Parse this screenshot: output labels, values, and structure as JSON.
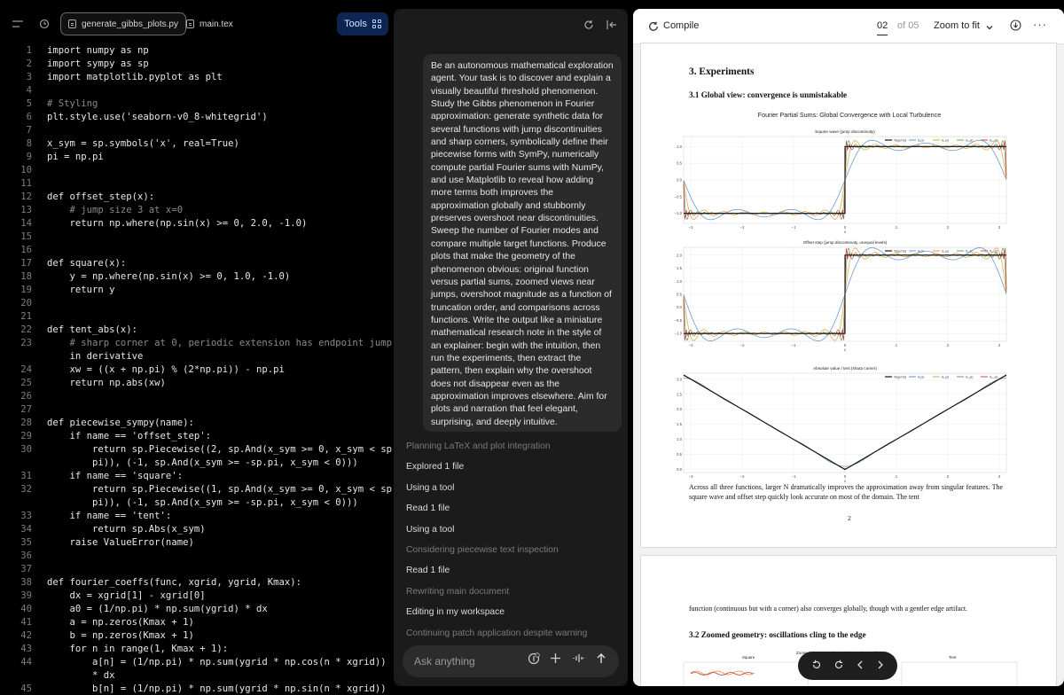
{
  "editor": {
    "tabs": [
      {
        "label": "generate_gibbs_plots.py",
        "active": true
      },
      {
        "label": "main.tex",
        "active": false
      }
    ],
    "tools_label": "Tools",
    "lines": [
      {
        "n": "1",
        "text": "import numpy as np"
      },
      {
        "n": "2",
        "text": "import sympy as sp"
      },
      {
        "n": "3",
        "text": "import matplotlib.pyplot as plt"
      },
      {
        "n": "4",
        "text": ""
      },
      {
        "n": "5",
        "text": "# Styling"
      },
      {
        "n": "6",
        "text": "plt.style.use('seaborn-v0_8-whitegrid')"
      },
      {
        "n": "7",
        "text": ""
      },
      {
        "n": "8",
        "text": "x_sym = sp.symbols('x', real=True)"
      },
      {
        "n": "9",
        "text": "pi = np.pi"
      },
      {
        "n": "10",
        "text": ""
      },
      {
        "n": "11",
        "text": ""
      },
      {
        "n": "12",
        "text": "def offset_step(x):"
      },
      {
        "n": "13",
        "text": "    # jump size 3 at x=0"
      },
      {
        "n": "14",
        "text": "    return np.where(np.sin(x) >= 0, 2.0, -1.0)"
      },
      {
        "n": "15",
        "text": ""
      },
      {
        "n": "16",
        "text": ""
      },
      {
        "n": "17",
        "text": "def square(x):"
      },
      {
        "n": "18",
        "text": "    y = np.where(np.sin(x) >= 0, 1.0, -1.0)"
      },
      {
        "n": "19",
        "text": "    return y"
      },
      {
        "n": "20",
        "text": ""
      },
      {
        "n": "21",
        "text": ""
      },
      {
        "n": "22",
        "text": "def tent_abs(x):"
      },
      {
        "n": "23",
        "text": "    # sharp corner at 0, periodic extension has endpoint jump"
      },
      {
        "n": "",
        "text": "    in derivative"
      },
      {
        "n": "24",
        "text": "    xw = ((x + np.pi) % (2*np.pi)) - np.pi"
      },
      {
        "n": "25",
        "text": "    return np.abs(xw)"
      },
      {
        "n": "26",
        "text": ""
      },
      {
        "n": "27",
        "text": ""
      },
      {
        "n": "28",
        "text": "def piecewise_sympy(name):"
      },
      {
        "n": "29",
        "text": "    if name == 'offset_step':"
      },
      {
        "n": "30",
        "text": "        return sp.Piecewise((2, sp.And(x_sym >= 0, x_sym < sp."
      },
      {
        "n": "",
        "text": "        pi)), (-1, sp.And(x_sym >= -sp.pi, x_sym < 0)))"
      },
      {
        "n": "31",
        "text": "    if name == 'square':"
      },
      {
        "n": "32",
        "text": "        return sp.Piecewise((1, sp.And(x_sym >= 0, x_sym < sp."
      },
      {
        "n": "",
        "text": "        pi)), (-1, sp.And(x_sym >= -sp.pi, x_sym < 0)))"
      },
      {
        "n": "33",
        "text": "    if name == 'tent':"
      },
      {
        "n": "34",
        "text": "        return sp.Abs(x_sym)"
      },
      {
        "n": "35",
        "text": "    raise ValueError(name)"
      },
      {
        "n": "36",
        "text": ""
      },
      {
        "n": "37",
        "text": ""
      },
      {
        "n": "38",
        "text": "def fourier_coeffs(func, xgrid, ygrid, Kmax):"
      },
      {
        "n": "39",
        "text": "    dx = xgrid[1] - xgrid[0]"
      },
      {
        "n": "40",
        "text": "    a0 = (1/np.pi) * np.sum(ygrid) * dx"
      },
      {
        "n": "41",
        "text": "    a = np.zeros(Kmax + 1)"
      },
      {
        "n": "42",
        "text": "    b = np.zeros(Kmax + 1)"
      },
      {
        "n": "43",
        "text": "    for n in range(1, Kmax + 1):"
      },
      {
        "n": "44",
        "text": "        a[n] = (1/np.pi) * np.sum(ygrid * np.cos(n * xgrid))"
      },
      {
        "n": "",
        "text": "        * dx"
      },
      {
        "n": "45",
        "text": "        b[n] = (1/np.pi) * np.sum(ygrid * np.sin(n * xgrid))"
      }
    ]
  },
  "chat": {
    "user_message": "Be an autonomous mathematical exploration agent. Your task is to discover and explain a visually beautiful threshold phenomenon. Study the Gibbs phenomenon in Fourier approximation: generate synthetic data for several functions with jump discontinuities and sharp corners, symbolically define their piecewise forms with SymPy, numerically compute partial Fourier sums with NumPy, and use Matplotlib to reveal how adding more terms both improves the approximation globally and stubbornly preserves overshoot near discontinuities. Sweep the number of Fourier modes and compare multiple target functions. Produce plots that make the geometry of the phenomenon obvious: original function versus partial sums, zoomed views near jumps, overshoot magnitude as a function of truncation order, and comparisons across functions. Write the output like a miniature mathematical research note in the style of an explainer: begin with the intuition, then run the experiments, then extract the pattern, then explain why the overshoot does not disappear even as the approximation improves elsewhere. Aim for plots and narration that feel elegant, surprising, and deeply intuitive.",
    "steps": [
      {
        "label": "Planning LaTeX and plot integration",
        "dim": true
      },
      {
        "label": "Explored 1 file",
        "dim": false
      },
      {
        "label": "Using a tool",
        "dim": false
      },
      {
        "label": "Read 1 file",
        "dim": false
      },
      {
        "label": "Using a tool",
        "dim": false
      },
      {
        "label": "Considering piecewise text inspection",
        "dim": true
      },
      {
        "label": "Read 1 file",
        "dim": false
      },
      {
        "label": "Rewriting main document",
        "dim": true
      },
      {
        "label": "Editing in my workspace",
        "dim": false
      },
      {
        "label": "Continuing patch application despite warning",
        "dim": true
      }
    ],
    "ask_placeholder": "Ask anything"
  },
  "pdf": {
    "compile_label": "Compile",
    "page_current": "02",
    "page_total": "of 05",
    "zoom_label": "Zoom to fit",
    "page2": {
      "section_title": "3.  Experiments",
      "subsection_title": "3.1 Global view: convergence is unmistakable",
      "figure_title": "Fourier Partial Sums: Global Convergence with Local Turbulence",
      "panels": [
        {
          "title": "Square wave (jump discontinuity)",
          "yticks": [
            "1.0",
            "0.5",
            "0.0",
            "−0.5",
            "−1.0"
          ]
        },
        {
          "title": "Offset step (jump discontinuity, unequal levels)",
          "yticks": [
            "2.0",
            "1.5",
            "1.0",
            "0.5",
            "0.0",
            "−0.5",
            "−1.0"
          ]
        },
        {
          "title": "Absolute value / tent (sharp corner)",
          "yticks": [
            "3.0",
            "2.5",
            "2.0",
            "1.5",
            "1.0",
            "0.5",
            "0.0"
          ]
        }
      ],
      "xticks": [
        "−3",
        "−2",
        "−1",
        "0",
        "1",
        "2",
        "3"
      ],
      "xlabel": "x",
      "legend": [
        "Target f(x)",
        "S₅(x)",
        "S₁₅(x)",
        "S₄₅(x)",
        "S₁₂₀(x)"
      ],
      "body": "Across all three functions, larger N dramatically improves the approximation away from singular features. The square wave and offset step quickly look accurate on most of the domain. The tent",
      "page_number": "2"
    },
    "page3": {
      "body": "function (continuous but with a corner) also converges globally, though with a gentler edge artifact.",
      "subsection_title": "3.2 Zoomed geometry: oscillations cling to the edge",
      "mini_title_a": "Square",
      "mini_title_b": "Zoomed Geometry: The Persistent Edge Oscillation",
      "mini_title_c": "Tent"
    }
  },
  "colors": {
    "target": "#111111",
    "s5": "#4c88c5",
    "s15": "#e9923a",
    "s45": "#4e9b48",
    "s120": "#c43a3a"
  },
  "chart_data": [
    {
      "type": "line",
      "title": "Square wave (jump discontinuity)",
      "xlabel": "x",
      "ylabel": "",
      "xlim": [
        -3.14,
        3.14
      ],
      "ylim": [
        -1.3,
        1.3
      ],
      "series": [
        {
          "name": "Target f(x)",
          "values": [
            [
              -3.14,
              -1
            ],
            [
              0,
              -1
            ],
            [
              0,
              1
            ],
            [
              3.14,
              1
            ]
          ]
        },
        {
          "name": "S₅(x)",
          "values": []
        },
        {
          "name": "S₁₅(x)",
          "values": []
        },
        {
          "name": "S₄₅(x)",
          "values": []
        },
        {
          "name": "S₁₂₀(x)",
          "values": []
        }
      ]
    },
    {
      "type": "line",
      "title": "Offset step (jump discontinuity, unequal levels)",
      "xlabel": "x",
      "ylabel": "",
      "xlim": [
        -3.14,
        3.14
      ],
      "ylim": [
        -1.3,
        2.3
      ],
      "series": [
        {
          "name": "Target f(x)",
          "values": [
            [
              -3.14,
              -1
            ],
            [
              0,
              -1
            ],
            [
              0,
              2
            ],
            [
              3.14,
              2
            ]
          ]
        }
      ]
    },
    {
      "type": "line",
      "title": "Absolute value / tent (sharp corner)",
      "xlabel": "x",
      "ylabel": "",
      "xlim": [
        -3.14,
        3.14
      ],
      "ylim": [
        -0.1,
        3.2
      ],
      "series": [
        {
          "name": "Target f(x)",
          "values": [
            [
              -3.14,
              3.14
            ],
            [
              0,
              0
            ],
            [
              3.14,
              3.14
            ]
          ]
        }
      ]
    }
  ]
}
